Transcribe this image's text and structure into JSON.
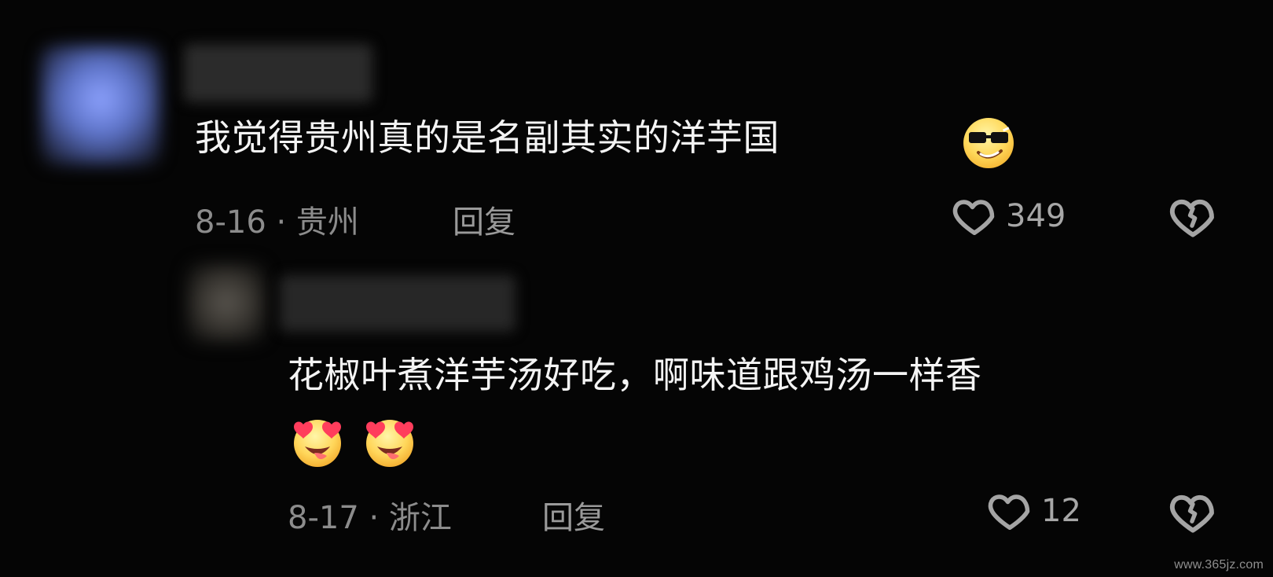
{
  "comments": [
    {
      "text": "我觉得贵州真的是名副其实的洋芋国",
      "emoji": "sunglasses-grin-emoji",
      "date_location": "8-16 · 贵州",
      "reply_label": "回复",
      "likes": "349",
      "like_icon": "heart-icon",
      "dislike_icon": "broken-heart-icon"
    },
    {
      "text": "花椒叶煮洋芋汤好吃，啊味道跟鸡汤一样香",
      "emoji": "heart-eyes-tongue-emoji",
      "date_location": "8-17 · 浙江",
      "reply_label": "回复",
      "likes": "12",
      "like_icon": "heart-icon",
      "dislike_icon": "broken-heart-icon"
    }
  ],
  "watermark": "www.365jz.com"
}
